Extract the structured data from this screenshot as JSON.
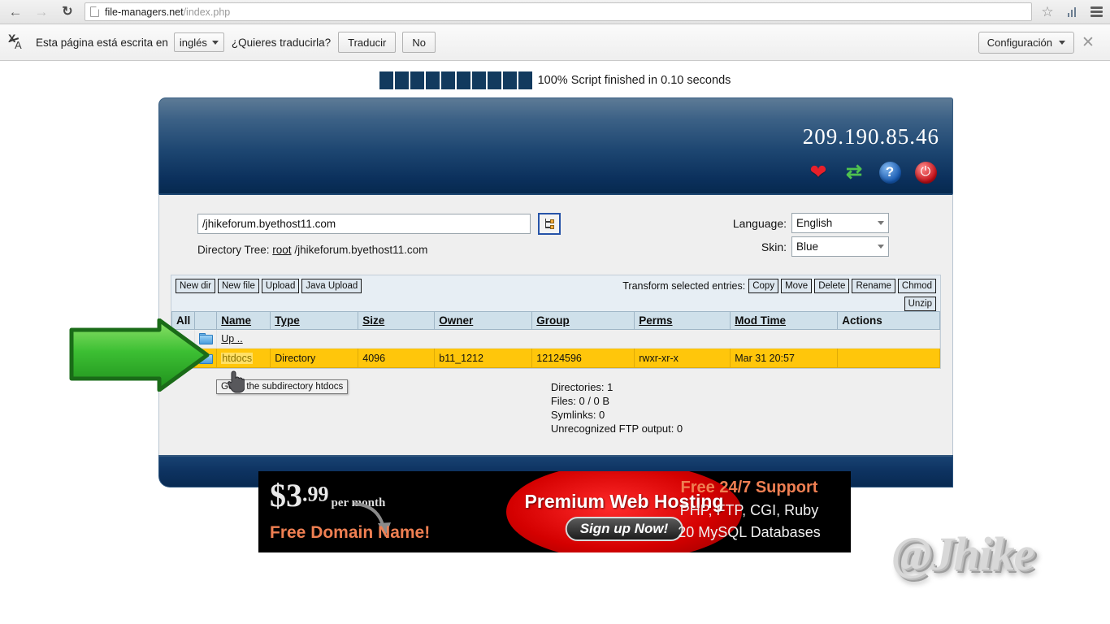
{
  "browser": {
    "back_icon": "back-arrow-icon",
    "forward_icon": "forward-arrow-icon",
    "reload_icon": "reload-icon",
    "url_host": "file-managers.net",
    "url_path": "/index.php",
    "star_icon": "star-bookmark-icon",
    "stats_icon": "bar-chart-icon",
    "menu_icon": "hamburger-menu-icon"
  },
  "translate_bar": {
    "icon": "translate-icon",
    "message": "Esta página está escrita en",
    "language_select": "inglés",
    "question": "¿Quieres traducirla?",
    "translate_button": "Traducir",
    "no_button": "No",
    "settings_button": "Configuración",
    "close_icon": "close-icon"
  },
  "progress": {
    "blocks": 10,
    "text": "100% Script finished in 0.10 seconds",
    "percent": "100%",
    "block_color": "#123a5e"
  },
  "app": {
    "ip_address": "209.190.85.46",
    "header_icons": [
      {
        "name": "heart-icon",
        "glyph": "♥",
        "color": "#e8202a"
      },
      {
        "name": "refresh-icon",
        "glyph": "⇄",
        "color": "#4fc24f"
      },
      {
        "name": "help-icon",
        "glyph": "?",
        "color": "#1558b0"
      },
      {
        "name": "power-icon",
        "glyph": "⏻",
        "color": "#c40d16"
      }
    ],
    "path_value": "/jhikeforum.byethost11.com",
    "tree_button_icon": "directory-tree-icon",
    "directory_tree_label": "Directory Tree:",
    "directory_tree_root": "root",
    "directory_tree_path": "/jhikeforum.byethost11.com",
    "language_label": "Language:",
    "language_value": "English",
    "skin_label": "Skin:",
    "skin_value": "Blue",
    "toolbar_buttons": [
      "New dir",
      "New file",
      "Upload",
      "Java Upload"
    ],
    "transform_label": "Transform selected entries:",
    "transform_buttons": [
      "Copy",
      "Move",
      "Delete",
      "Rename",
      "Chmod"
    ],
    "unzip_button": "Unzip",
    "columns": [
      "All",
      "",
      "Name",
      "Type",
      "Size",
      "Owner",
      "Group",
      "Perms",
      "Mod Time",
      "Actions"
    ],
    "rows": [
      {
        "name": "Up ..",
        "type": "",
        "size": "",
        "owner": "",
        "group": "",
        "perms": "",
        "mod_time": "",
        "actions": "",
        "selected": false,
        "icon": "folder-icon"
      },
      {
        "name": "htdocs",
        "type": "Directory",
        "size": "4096",
        "owner": "b11_1212",
        "group": "12124596",
        "perms": "rwxr-xr-x",
        "mod_time": "Mar 31 20:57",
        "actions": "",
        "selected": true,
        "icon": "folder-icon"
      }
    ],
    "stats": [
      "Directories: 1",
      "Files: 0 / 0 B",
      "Symlinks: 0",
      "Unrecognized FTP output: 0"
    ],
    "selected_row_color": "#FFC60B"
  },
  "tooltip": {
    "text": "Go to the subdirectory htdocs"
  },
  "annotation": {
    "arrow_name": "green-pointer-arrow",
    "arrow_color": "#3fc63f"
  },
  "ad": {
    "price_currency": "$",
    "price_whole": "3",
    "price_cents": ".99",
    "per_month": "per month",
    "free_domain": "Free Domain Name!",
    "headline": "Premium Web Hosting",
    "cta": "Sign up Now!",
    "support": "Free 24/7 Support",
    "tech": "PHP, FTP, CGI, Ruby",
    "databases": "20 MySQL Databases"
  },
  "watermark": {
    "text": "@Jhike"
  }
}
